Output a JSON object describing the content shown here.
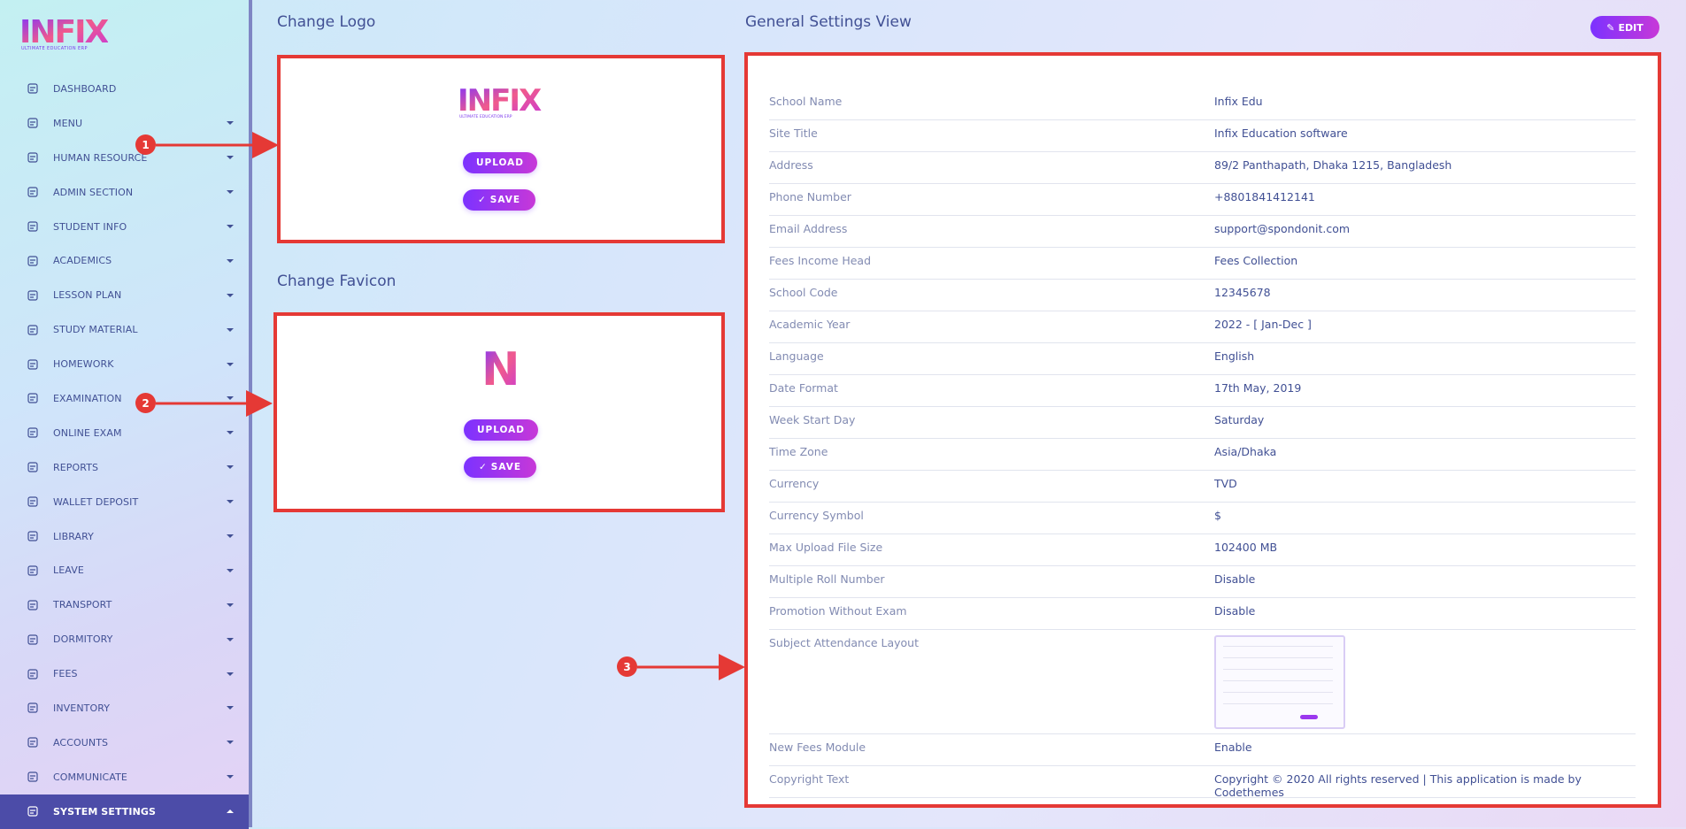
{
  "brand": {
    "logo_text": "INFIX",
    "tagline": "ULTIMATE EDUCATION ERP"
  },
  "sidebar": {
    "items": [
      {
        "label": "DASHBOARD",
        "icon": "dashboard-icon"
      },
      {
        "label": "MENU",
        "icon": "menu-icon"
      },
      {
        "label": "HUMAN RESOURCE",
        "icon": "human-resource-icon"
      },
      {
        "label": "ADMIN SECTION",
        "icon": "admin-section-icon"
      },
      {
        "label": "STUDENT INFO",
        "icon": "student-info-icon"
      },
      {
        "label": "ACADEMICS",
        "icon": "academics-icon"
      },
      {
        "label": "LESSON PLAN",
        "icon": "lesson-plan-icon"
      },
      {
        "label": "STUDY MATERIAL",
        "icon": "study-material-icon"
      },
      {
        "label": "HOMEWORK",
        "icon": "homework-icon"
      },
      {
        "label": "EXAMINATION",
        "icon": "examination-icon"
      },
      {
        "label": "ONLINE EXAM",
        "icon": "online-exam-icon"
      },
      {
        "label": "REPORTS",
        "icon": "reports-icon"
      },
      {
        "label": "WALLET DEPOSIT",
        "icon": "wallet-deposit-icon"
      },
      {
        "label": "LIBRARY",
        "icon": "library-icon"
      },
      {
        "label": "LEAVE",
        "icon": "leave-icon"
      },
      {
        "label": "TRANSPORT",
        "icon": "transport-icon"
      },
      {
        "label": "DORMITORY",
        "icon": "dormitory-icon"
      },
      {
        "label": "FEES",
        "icon": "fees-icon"
      },
      {
        "label": "INVENTORY",
        "icon": "inventory-icon"
      },
      {
        "label": "ACCOUNTS",
        "icon": "accounts-icon"
      },
      {
        "label": "COMMUNICATE",
        "icon": "communicate-icon"
      },
      {
        "label": "SYSTEM SETTINGS",
        "icon": "gear-icon",
        "active": true
      }
    ]
  },
  "logo_section": {
    "title": "Change Logo",
    "upload_label": "UPLOAD",
    "save_label": "SAVE"
  },
  "favicon_section": {
    "title": "Change Favicon",
    "upload_label": "UPLOAD",
    "save_label": "SAVE",
    "favicon_letter": "N"
  },
  "general": {
    "title": "General Settings View",
    "edit_label": "EDIT",
    "rows": [
      {
        "label": "School Name",
        "value": "Infix Edu"
      },
      {
        "label": "Site Title",
        "value": "Infix Education software"
      },
      {
        "label": "Address",
        "value": "89/2 Panthapath, Dhaka 1215, Bangladesh"
      },
      {
        "label": "Phone Number",
        "value": "+8801841412141"
      },
      {
        "label": "Email Address",
        "value": "support@spondonit.com"
      },
      {
        "label": "Fees Income Head",
        "value": "Fees Collection"
      },
      {
        "label": "School Code",
        "value": "12345678"
      },
      {
        "label": "Academic Year",
        "value": "2022 - [ Jan-Dec ]"
      },
      {
        "label": "Language",
        "value": "English"
      },
      {
        "label": "Date Format",
        "value": "17th May, 2019"
      },
      {
        "label": "Week Start Day",
        "value": "Saturday"
      },
      {
        "label": "Time Zone",
        "value": "Asia/Dhaka"
      },
      {
        "label": "Currency",
        "value": "TVD"
      },
      {
        "label": "Currency Symbol",
        "value": "$"
      },
      {
        "label": "Max Upload File Size",
        "value": "102400 MB"
      },
      {
        "label": "Multiple Roll Number",
        "value": "Disable"
      },
      {
        "label": "Promotion Without Exam",
        "value": "Disable"
      },
      {
        "label": "Subject Attendance Layout",
        "value": ""
      },
      {
        "label": "New Fees Module",
        "value": "Enable"
      },
      {
        "label": "Copyright Text",
        "value": "Copyright © 2020 All rights reserved | This application is made by Codethemes"
      }
    ]
  },
  "annotations": {
    "one": "1",
    "two": "2",
    "three": "3"
  },
  "colors": {
    "accent_start": "#7c32ff",
    "accent_end": "#c738d8",
    "annotation": "#e53935",
    "text": "#415094"
  }
}
